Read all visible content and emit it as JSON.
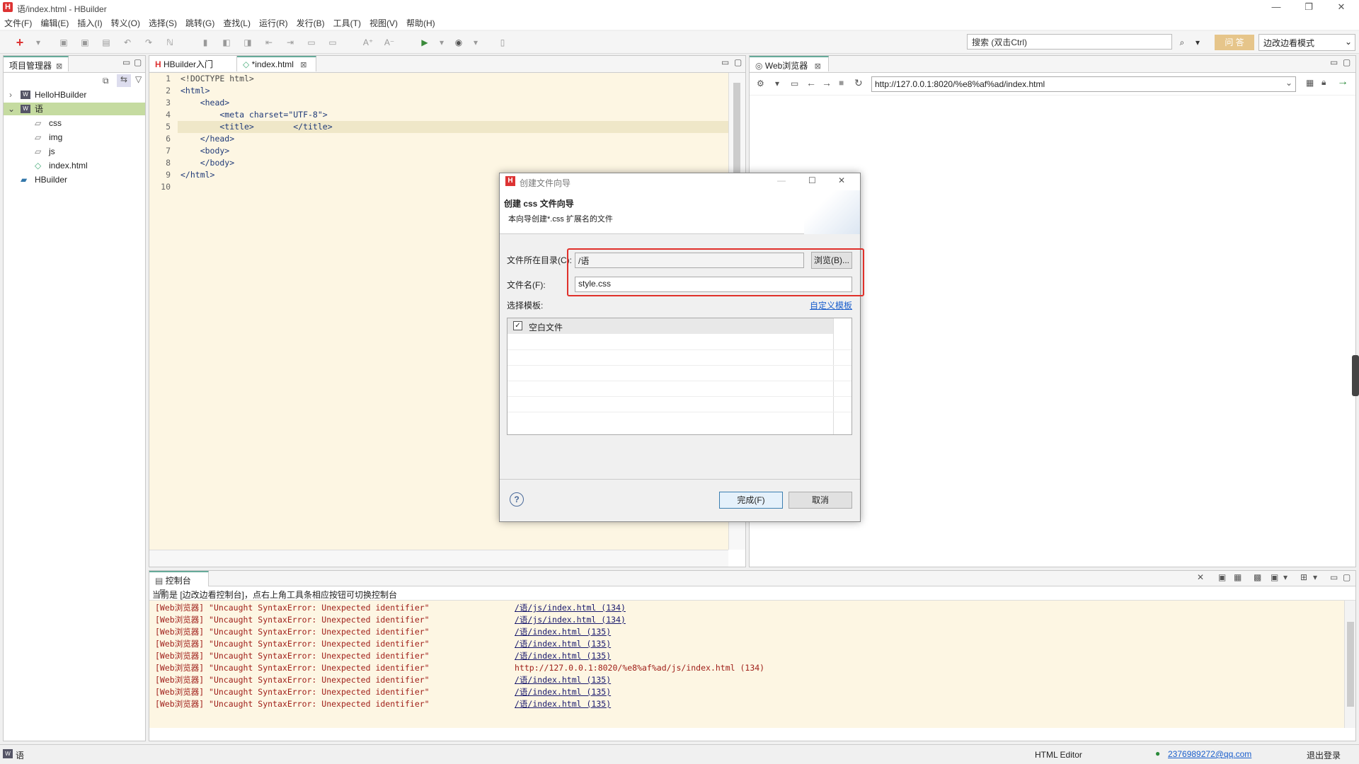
{
  "window": {
    "title": "语/index.html  -  HBuilder",
    "minimize": "—",
    "restore": "❐",
    "close": "✕"
  },
  "menu": [
    "文件(F)",
    "编辑(E)",
    "插入(I)",
    "转义(O)",
    "选择(S)",
    "跳转(G)",
    "查找(L)",
    "运行(R)",
    "发行(B)",
    "工具(T)",
    "视图(V)",
    "帮助(H)"
  ],
  "toolbar": {
    "search_placeholder": "搜索 (双击Ctrl)",
    "qa_label": "问 答",
    "mode_label": "边改边看模式"
  },
  "project_panel": {
    "tab_label": "项目管理器",
    "items": [
      {
        "label": "HelloHBuilder",
        "icon": "web-project-icon"
      },
      {
        "label": "语",
        "icon": "web-project-icon"
      },
      {
        "label": "css",
        "icon": "folder-icon"
      },
      {
        "label": "img",
        "icon": "folder-icon"
      },
      {
        "label": "js",
        "icon": "folder-icon"
      },
      {
        "label": "index.html",
        "icon": "html-file-icon"
      },
      {
        "label": "HBuilder",
        "icon": "folder-icon"
      }
    ]
  },
  "editor": {
    "tabs": [
      {
        "label": "HBuilder入门"
      },
      {
        "label": "*index.html"
      }
    ],
    "lines": [
      {
        "num": "1",
        "text": "<!DOCTYPE html>"
      },
      {
        "num": "2",
        "text": "<html>"
      },
      {
        "num": "3",
        "text": "    <head>"
      },
      {
        "num": "4",
        "text": "        <meta charset=\"UTF-8\">"
      },
      {
        "num": "5",
        "text": "        <title>        </title>"
      },
      {
        "num": "6",
        "text": "    </head>"
      },
      {
        "num": "7",
        "text": "    <body>"
      },
      {
        "num": "8",
        "text": "    </body>"
      },
      {
        "num": "9",
        "text": "</html>"
      },
      {
        "num": "10",
        "text": ""
      }
    ]
  },
  "browser": {
    "tab_label": "Web浏览器",
    "url": "http://127.0.0.1:8020/%e8%af%ad/index.html"
  },
  "console": {
    "tab_label": "控制台",
    "notice": "当前是 [边改边看控制台]，点右上角工具条相应按钮可切换控制台",
    "lines": [
      {
        "text": "[Web浏览器] \"Uncaught SyntaxError: Unexpected identifier\"",
        "link": "/语/js/index.html (134)"
      },
      {
        "text": "[Web浏览器] \"Uncaught SyntaxError: Unexpected identifier\"",
        "link": "/语/js/index.html (134)"
      },
      {
        "text": "[Web浏览器] \"Uncaught SyntaxError: Unexpected identifier\"",
        "link": "/语/index.html (135)"
      },
      {
        "text": "[Web浏览器] \"Uncaught SyntaxError: Unexpected identifier\"",
        "link": "/语/index.html (135)"
      },
      {
        "text": "[Web浏览器] \"Uncaught SyntaxError: Unexpected identifier\"",
        "link": "/语/index.html (135)"
      },
      {
        "text": "[Web浏览器] \"Uncaught SyntaxError: Unexpected identifier\"",
        "link": "http://127.0.0.1:8020/%e8%af%ad/js/index.html (134)"
      },
      {
        "text": "[Web浏览器] \"Uncaught SyntaxError: Unexpected identifier\"",
        "link": "/语/index.html (135)"
      },
      {
        "text": "[Web浏览器] \"Uncaught SyntaxError: Unexpected identifier\"",
        "link": "/语/index.html (135)"
      },
      {
        "text": "[Web浏览器] \"Uncaught SyntaxError: Unexpected identifier\"",
        "link": "/语/index.html (135)"
      }
    ]
  },
  "dialog": {
    "window_title": "创建文件向导",
    "heading": "创建 css 文件向导",
    "subheading": "本向导创建*.css 扩展名的文件",
    "dir_label": "文件所在目录(C):",
    "dir_value": "/语",
    "browse_label": "浏览(B)...",
    "name_label": "文件名(F):",
    "name_value": "style.css",
    "template_label": "选择模板:",
    "custom_template_link": "自定义模板",
    "template_item": "空白文件",
    "template_checked": true,
    "finish_label": "完成(F)",
    "cancel_label": "取消",
    "help_icon": "?"
  },
  "statusbar": {
    "project": "语",
    "editor_type": "HTML Editor",
    "user": "2376989272@qq.com",
    "extra": "退出登录"
  },
  "colors": {
    "highlight_box": "#e0302a",
    "selection": "#c5dba0",
    "editor_bg": "#fdf6e3"
  }
}
